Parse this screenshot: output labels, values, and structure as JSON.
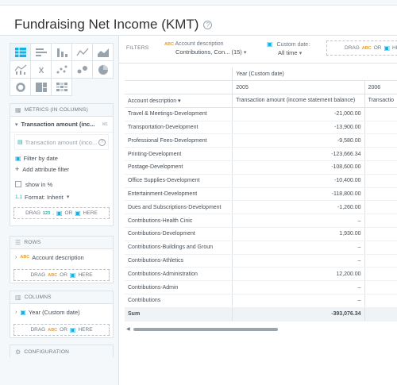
{
  "title": "Fundraising Net Income (KMT)",
  "filters": {
    "label": "FILTERS",
    "items": [
      {
        "name": "Account description",
        "value": "Contributions, Con...",
        "count": "(15)"
      },
      {
        "name": "Custom date:",
        "value": "All time"
      }
    ],
    "drag_text": "DRAG",
    "drag_or": "OR",
    "drag_here": "HE"
  },
  "sidebar": {
    "metrics_header": "METRICS (IN COLUMNS)",
    "metric_name": "Transaction amount (inc...",
    "metric_tag": "M1",
    "metric_sub": "Transaction amount (inco...",
    "filter_by_date": "Filter by date",
    "add_attribute_filter": "Add attribute filter",
    "show_in_pct": "show in %",
    "format_prefix": "1.1",
    "format_label": "Format: Inherit",
    "drag_metric": {
      "drag": "DRAG",
      "num": "123",
      "or": "OR",
      "here": "HERE"
    },
    "rows_header": "ROWS",
    "row_attr": "Account description",
    "drag_rows": {
      "drag": "DRAG",
      "abc": "ABC",
      "or": "OR",
      "here": "HERE"
    },
    "columns_header": "COLUMNS",
    "column_attr": "Year (Custom date)",
    "drag_cols": {
      "drag": "DRAG",
      "abc": "ABC",
      "or": "OR",
      "here": "HERE"
    },
    "configuration_header": "CONFIGURATION"
  },
  "table": {
    "col_group": "Year (Custom date)",
    "years": [
      "2005",
      "2006"
    ],
    "row_header": "Account description",
    "measure_header": "Transaction amount (income statement balance)",
    "measure_header_trunc": "Transactio",
    "rows": [
      {
        "label": "Travel & Meetings-Development",
        "value": "-21,000.00"
      },
      {
        "label": "Transportation-Development",
        "value": "-13,900.00"
      },
      {
        "label": "Professional Fees-Development",
        "value": "-9,580.00"
      },
      {
        "label": "Printing-Development",
        "value": "-123,666.34"
      },
      {
        "label": "Postage-Development",
        "value": "-108,600.00"
      },
      {
        "label": "Office Supplies-Development",
        "value": "-10,400.00"
      },
      {
        "label": "Entertainment-Development",
        "value": "-118,800.00"
      },
      {
        "label": "Dues and Subscriptions-Development",
        "value": "-1,260.00"
      },
      {
        "label": "Contributions-Health Cinic",
        "value": "–"
      },
      {
        "label": "Contributions-Development",
        "value": "1,930.00"
      },
      {
        "label": "Contributions-Buildings and Groun",
        "value": "–"
      },
      {
        "label": "Contributions-Athletics",
        "value": "–"
      },
      {
        "label": "Contributions-Administration",
        "value": "12,200.00"
      },
      {
        "label": "Contributions-Admin",
        "value": "–"
      },
      {
        "label": "Contributions",
        "value": "–"
      }
    ],
    "sum_label": "Sum",
    "sum_value": "-393,076.34"
  }
}
